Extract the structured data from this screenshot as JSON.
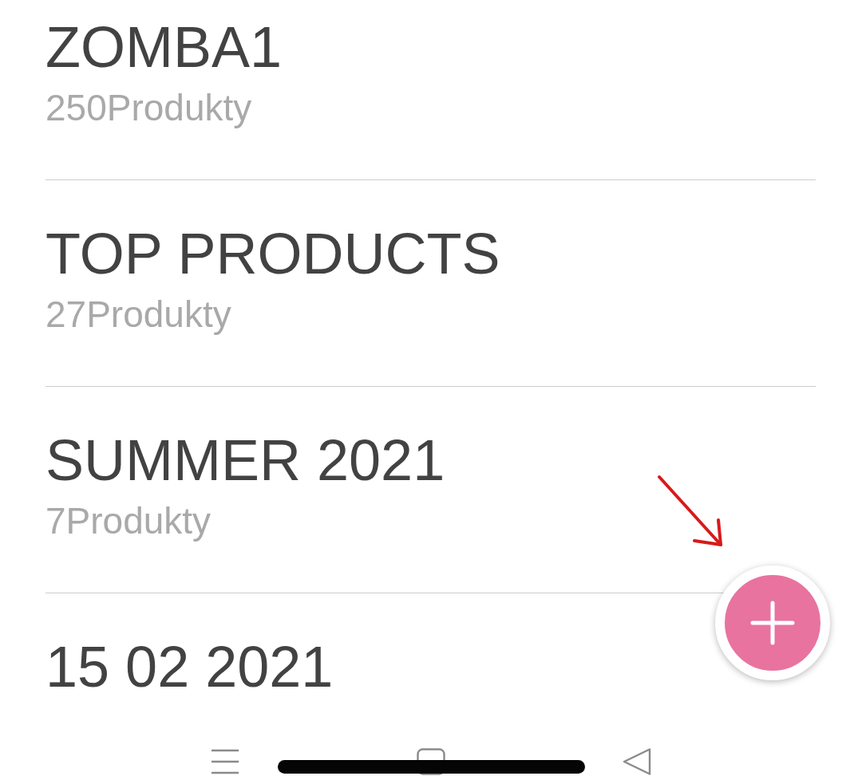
{
  "collections": [
    {
      "name": "ZOMBA1",
      "count": "250Produkty"
    },
    {
      "name": "TOP PRODUCTS",
      "count": "27Produkty"
    },
    {
      "name": "SUMMER 2021",
      "count": "7Produkty"
    },
    {
      "name": "15 02 2021"
    }
  ]
}
